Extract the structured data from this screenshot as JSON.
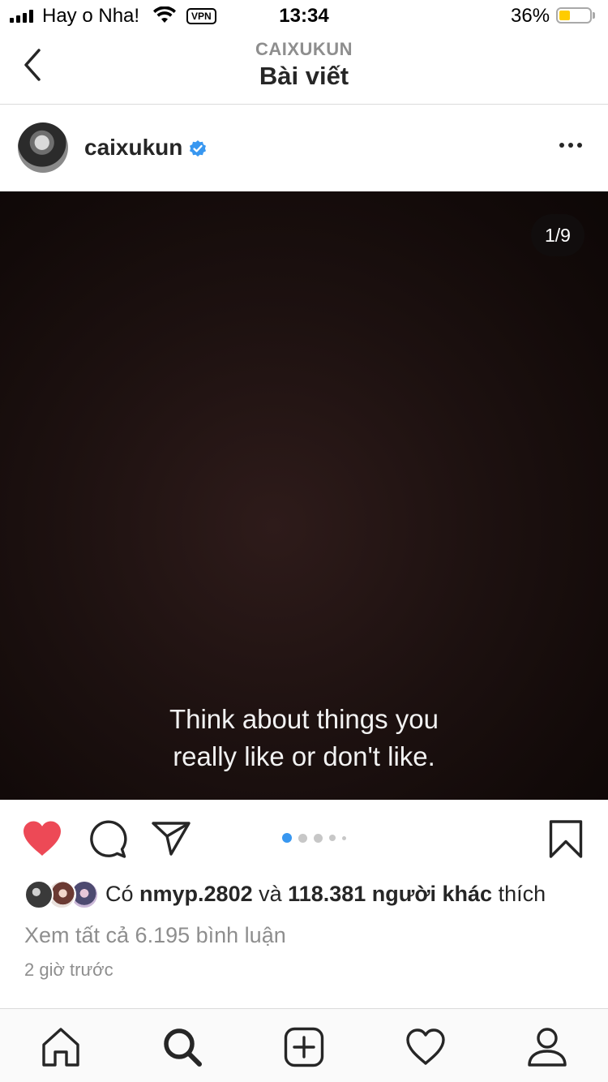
{
  "status_bar": {
    "carrier": "Hay o Nha!",
    "vpn": "VPN",
    "time": "13:34",
    "battery_percent": "36%",
    "battery_level": 0.36,
    "battery_color": "#ffcc00"
  },
  "header": {
    "account": "CAIXUKUN",
    "title": "Bài viết"
  },
  "post": {
    "username": "caixukun",
    "verified": true,
    "counter": "1/9",
    "image_text": [
      "Think about things you",
      "really like or don't like."
    ],
    "carousel": {
      "current": 1,
      "total": 9
    },
    "liked": true,
    "likes": {
      "prefix": "Có",
      "user": "nmyp.2802",
      "connector": "và",
      "others": "118.381 người khác",
      "suffix": "thích"
    },
    "comments_link": "Xem tất cả 6.195 bình luận",
    "time_ago": "2 giờ trước"
  },
  "colors": {
    "like_red": "#ed4956",
    "verified_blue": "#3897f0",
    "active_dot": "#3897f0",
    "text_secondary": "#8e8e8e"
  },
  "icons": {
    "back": "chevron-left-icon",
    "more": "more-horizontal-icon",
    "like": "heart-filled-icon",
    "comment": "comment-icon",
    "share": "send-icon",
    "save": "bookmark-icon",
    "tabs": [
      "home-icon",
      "search-icon",
      "add-post-icon",
      "activity-heart-icon",
      "profile-icon"
    ]
  }
}
